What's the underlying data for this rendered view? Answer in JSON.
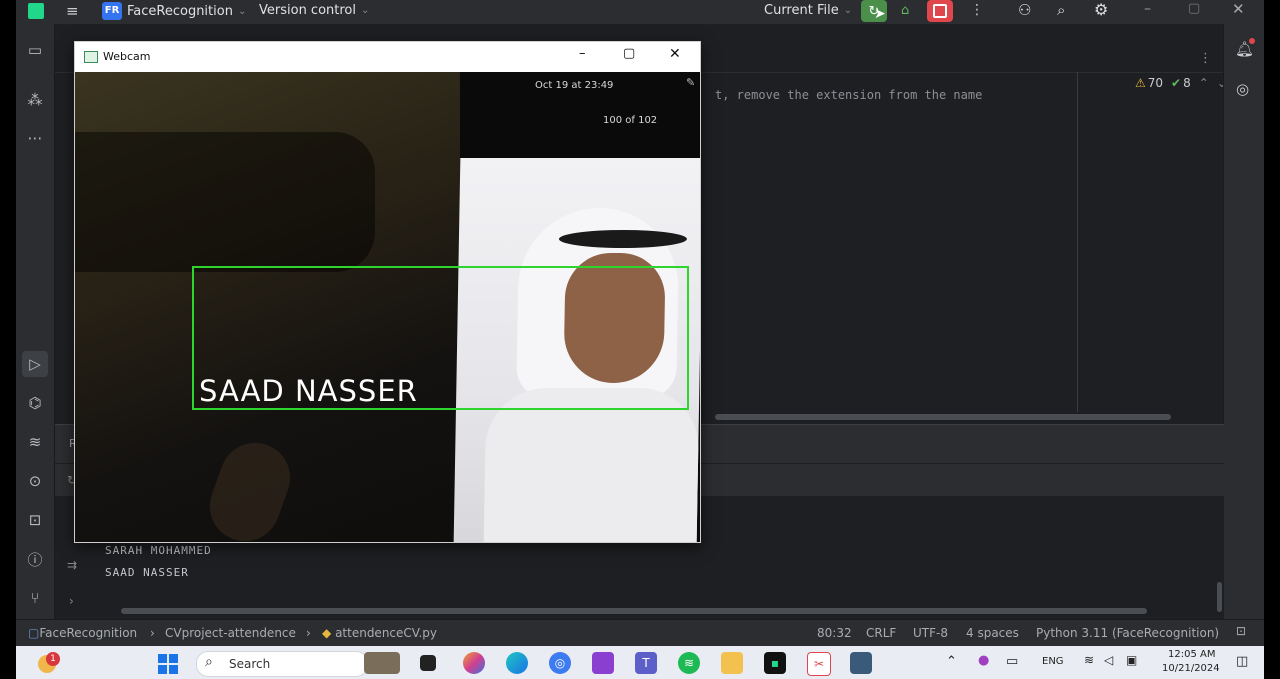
{
  "ide": {
    "project_badge": "FR",
    "project_name": "FaceRecognition",
    "vcs_label": "Version control",
    "run_config": "Current File",
    "code_fragment": "t, remove the extension from the name",
    "warnings_count": "70",
    "ok_count": "8"
  },
  "console": {
    "lines": [
      "SARAH MOHAMMED",
      "SAAD NASSER"
    ]
  },
  "statusbar": {
    "breadcrumb_project": "FaceRecognition",
    "breadcrumb_folder": "CVproject-attendence",
    "breadcrumb_file": "attendenceCV.py",
    "position": "80:32",
    "line_ending": "CRLF",
    "encoding": "UTF-8",
    "indent": "4 spaces",
    "interpreter": "Python 3.11 (FaceRecognition)"
  },
  "webcam": {
    "title": "Webcam",
    "phone_date": "Oct 19 at 23:49",
    "phone_counter": "100 of 102",
    "face_label": "SAAD NASSER",
    "box_color": "#2fd52f"
  },
  "taskbar": {
    "search_placeholder": "Search",
    "notification_count": "1",
    "language": "ENG",
    "time": "12:05 AM",
    "date": "10/21/2024"
  }
}
